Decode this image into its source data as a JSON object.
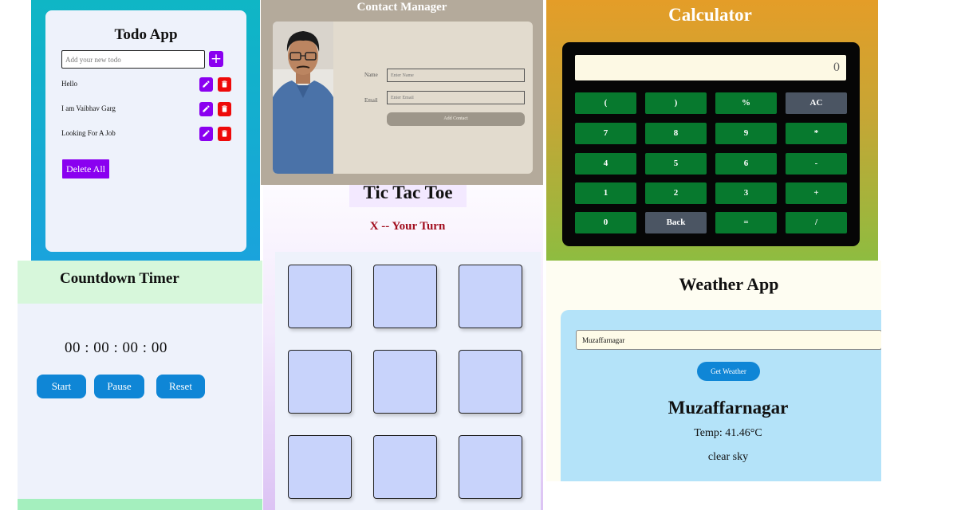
{
  "todo": {
    "title": "Todo App",
    "input_placeholder": "Add your new todo",
    "add_label": "+",
    "items": [
      {
        "text": "Hello"
      },
      {
        "text": "I am Vaibhav Garg"
      },
      {
        "text": "Looking For A Job"
      }
    ],
    "delete_all_label": "Delete All",
    "colors": {
      "accent": "#8a00f0",
      "danger": "#ee0a0a"
    }
  },
  "contact": {
    "title": "Contact Manager",
    "name_label": "Name",
    "name_placeholder": "Enter Name",
    "email_label": "Email",
    "email_placeholder": "Enter Email",
    "add_button": "Add Contact",
    "photo": "profile-photo"
  },
  "calculator": {
    "title": "Calculator",
    "display": "0",
    "keys": [
      [
        "(",
        ")",
        "%",
        "AC"
      ],
      [
        "7",
        "8",
        "9",
        "*"
      ],
      [
        "4",
        "5",
        "6",
        "-"
      ],
      [
        "1",
        "2",
        "3",
        "+"
      ],
      [
        "0",
        "Back",
        "=",
        "/"
      ]
    ],
    "colors": {
      "key": "#07792e",
      "special_key": "#4b5563"
    }
  },
  "tictactoe": {
    "title": "Tic Tac Toe",
    "status": "X -- Your Turn",
    "cells": [
      "",
      "",
      "",
      "",
      "",
      "",
      "",
      "",
      ""
    ]
  },
  "countdown": {
    "title": "Countdown Timer",
    "time": "00 : 00 : 00 : 00",
    "buttons": {
      "start": "Start",
      "pause": "Pause",
      "reset": "Reset"
    }
  },
  "weather": {
    "title": "Weather App",
    "city_input": "Muzaffarnagar",
    "get_button": "Get Weather",
    "city": "Muzaffarnagar",
    "temp": "Temp: 41.46°C",
    "description": "clear sky"
  }
}
